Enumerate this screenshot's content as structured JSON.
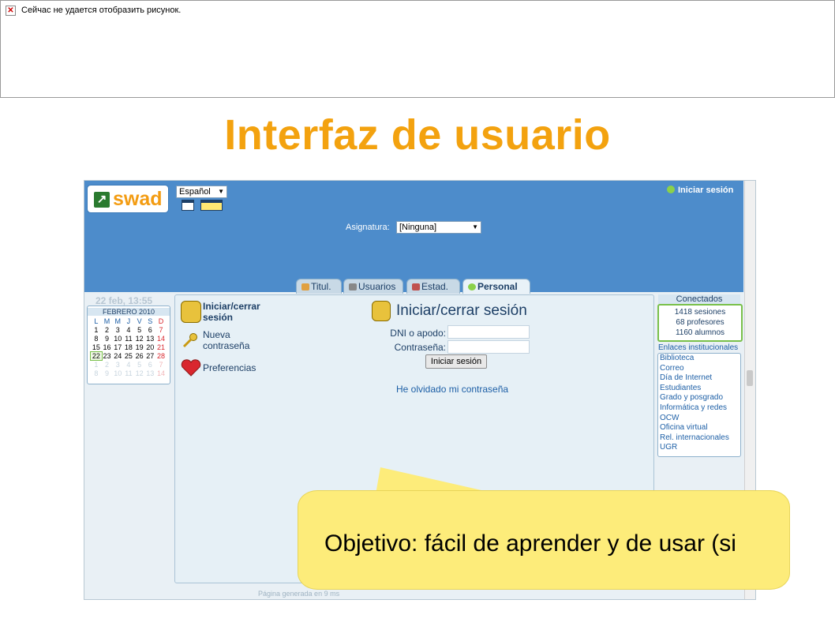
{
  "broken_image": {
    "message": "Сейчас не удается отобразить рисунок."
  },
  "slide": {
    "title": "Interfaz de usuario"
  },
  "app": {
    "logo": "swad",
    "language": "Español",
    "login_link": "Iniciar sesión",
    "asignatura_label": "Asignatura:",
    "asignatura_value": "[Ninguna]",
    "tabs": [
      {
        "label": "Titul."
      },
      {
        "label": "Usuarios"
      },
      {
        "label": "Estad."
      },
      {
        "label": "Personal"
      }
    ],
    "datetime": "22 feb, 13:55",
    "calendar": {
      "month": "FEBRERO 2010",
      "headers": [
        "L",
        "M",
        "M",
        "J",
        "V",
        "S",
        "D"
      ],
      "weeks": [
        [
          "1",
          "2",
          "3",
          "4",
          "5",
          "6",
          "7"
        ],
        [
          "8",
          "9",
          "10",
          "11",
          "12",
          "13",
          "14"
        ],
        [
          "15",
          "16",
          "17",
          "18",
          "19",
          "20",
          "21"
        ],
        [
          "22",
          "23",
          "24",
          "25",
          "26",
          "27",
          "28"
        ],
        [
          "1",
          "2",
          "3",
          "4",
          "5",
          "6",
          "7"
        ],
        [
          "8",
          "9",
          "10",
          "11",
          "12",
          "13",
          "14"
        ]
      ],
      "today": "22"
    },
    "menu": {
      "login": "Iniciar/cerrar sesión",
      "new_password": "Nueva contraseña",
      "preferences": "Preferencias"
    },
    "form": {
      "title": "Iniciar/cerrar sesión",
      "dni_label": "DNI o apodo:",
      "password_label": "Contraseña:",
      "submit": "Iniciar sesión",
      "forgot": "He olvidado mi contraseña"
    },
    "connected": {
      "title": "Conectados",
      "sessions": "1418 sesiones",
      "teachers": "68 profesores",
      "students": "1160 alumnos"
    },
    "links": {
      "title": "Enlaces institucionales",
      "items": [
        "Biblioteca",
        "Correo",
        "Día de Internet",
        "Estudiantes",
        "Grado y posgrado",
        "Informática y redes",
        "OCW",
        "Oficina virtual",
        "Rel. internacionales",
        "UGR"
      ]
    },
    "footer": "Página generada en 9 ms"
  },
  "callout": {
    "text": "Objetivo: fácil de aprender y de usar (si"
  },
  "colors": {
    "title": "#f3a20f",
    "header": "#4d8ccb",
    "callout": "#fdec7a"
  }
}
